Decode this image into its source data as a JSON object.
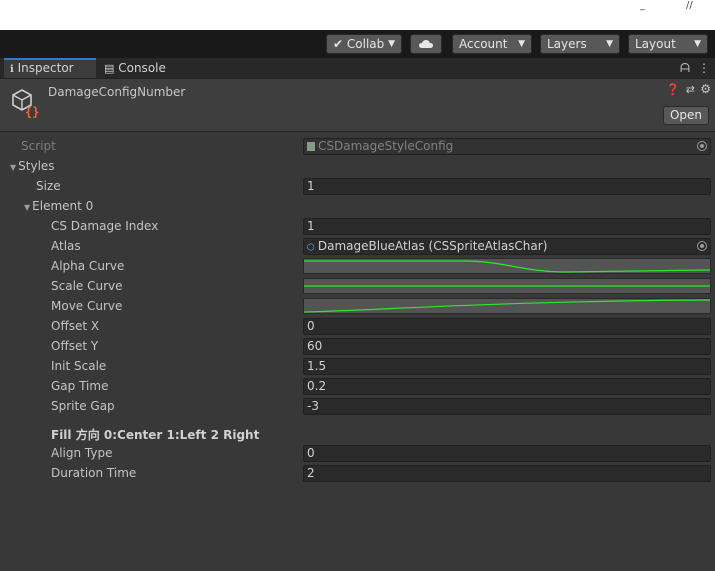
{
  "topstrip": {
    "mini_left": "_",
    "mini_right": "//"
  },
  "toolbar": {
    "collab_label": "Collab",
    "cloud_icon": "cloud-icon",
    "account_label": "Account",
    "layers_label": "Layers",
    "layout_label": "Layout"
  },
  "tabs": [
    {
      "label": "Inspector",
      "icon": "info-icon",
      "active": true
    },
    {
      "label": "Console",
      "icon": "console-icon",
      "active": false
    }
  ],
  "header": {
    "title": "DamageConfigNumber",
    "open_label": "Open",
    "icons": [
      "help-icon",
      "preset-icon",
      "settings-icon"
    ]
  },
  "fields": {
    "script": {
      "label": "Script",
      "value": "CSDamageStyleConfig"
    },
    "styles": {
      "label": "Styles"
    },
    "size": {
      "label": "Size",
      "value": "1"
    },
    "element0": {
      "label": "Element 0"
    },
    "damage_index": {
      "label": "CS Damage Index",
      "value": "1"
    },
    "atlas": {
      "label": "Atlas",
      "value": "DamageBlueAtlas (CSSpriteAtlasChar)"
    },
    "alpha_curve": {
      "label": "Alpha Curve"
    },
    "scale_curve": {
      "label": "Scale Curve"
    },
    "move_curve": {
      "label": "Move Curve"
    },
    "offset_x": {
      "label": "Offset X",
      "value": "0"
    },
    "offset_y": {
      "label": "Offset Y",
      "value": "60"
    },
    "init_scale": {
      "label": "Init Scale",
      "value": "1.5"
    },
    "gap_time": {
      "label": "Gap Time",
      "value": "0.2"
    },
    "sprite_gap": {
      "label": "Sprite Gap",
      "value": "-3"
    },
    "fill_header": {
      "label": "Fill 方向 0:Center 1:Left 2 Right"
    },
    "align_type": {
      "label": "Align Type",
      "value": "0"
    },
    "duration_time": {
      "label": "Duration Time",
      "value": "2"
    }
  },
  "colors": {
    "curve": "#2ee62e",
    "accent": "#3a79bb",
    "script_icon_warm": "#e86a3a"
  }
}
